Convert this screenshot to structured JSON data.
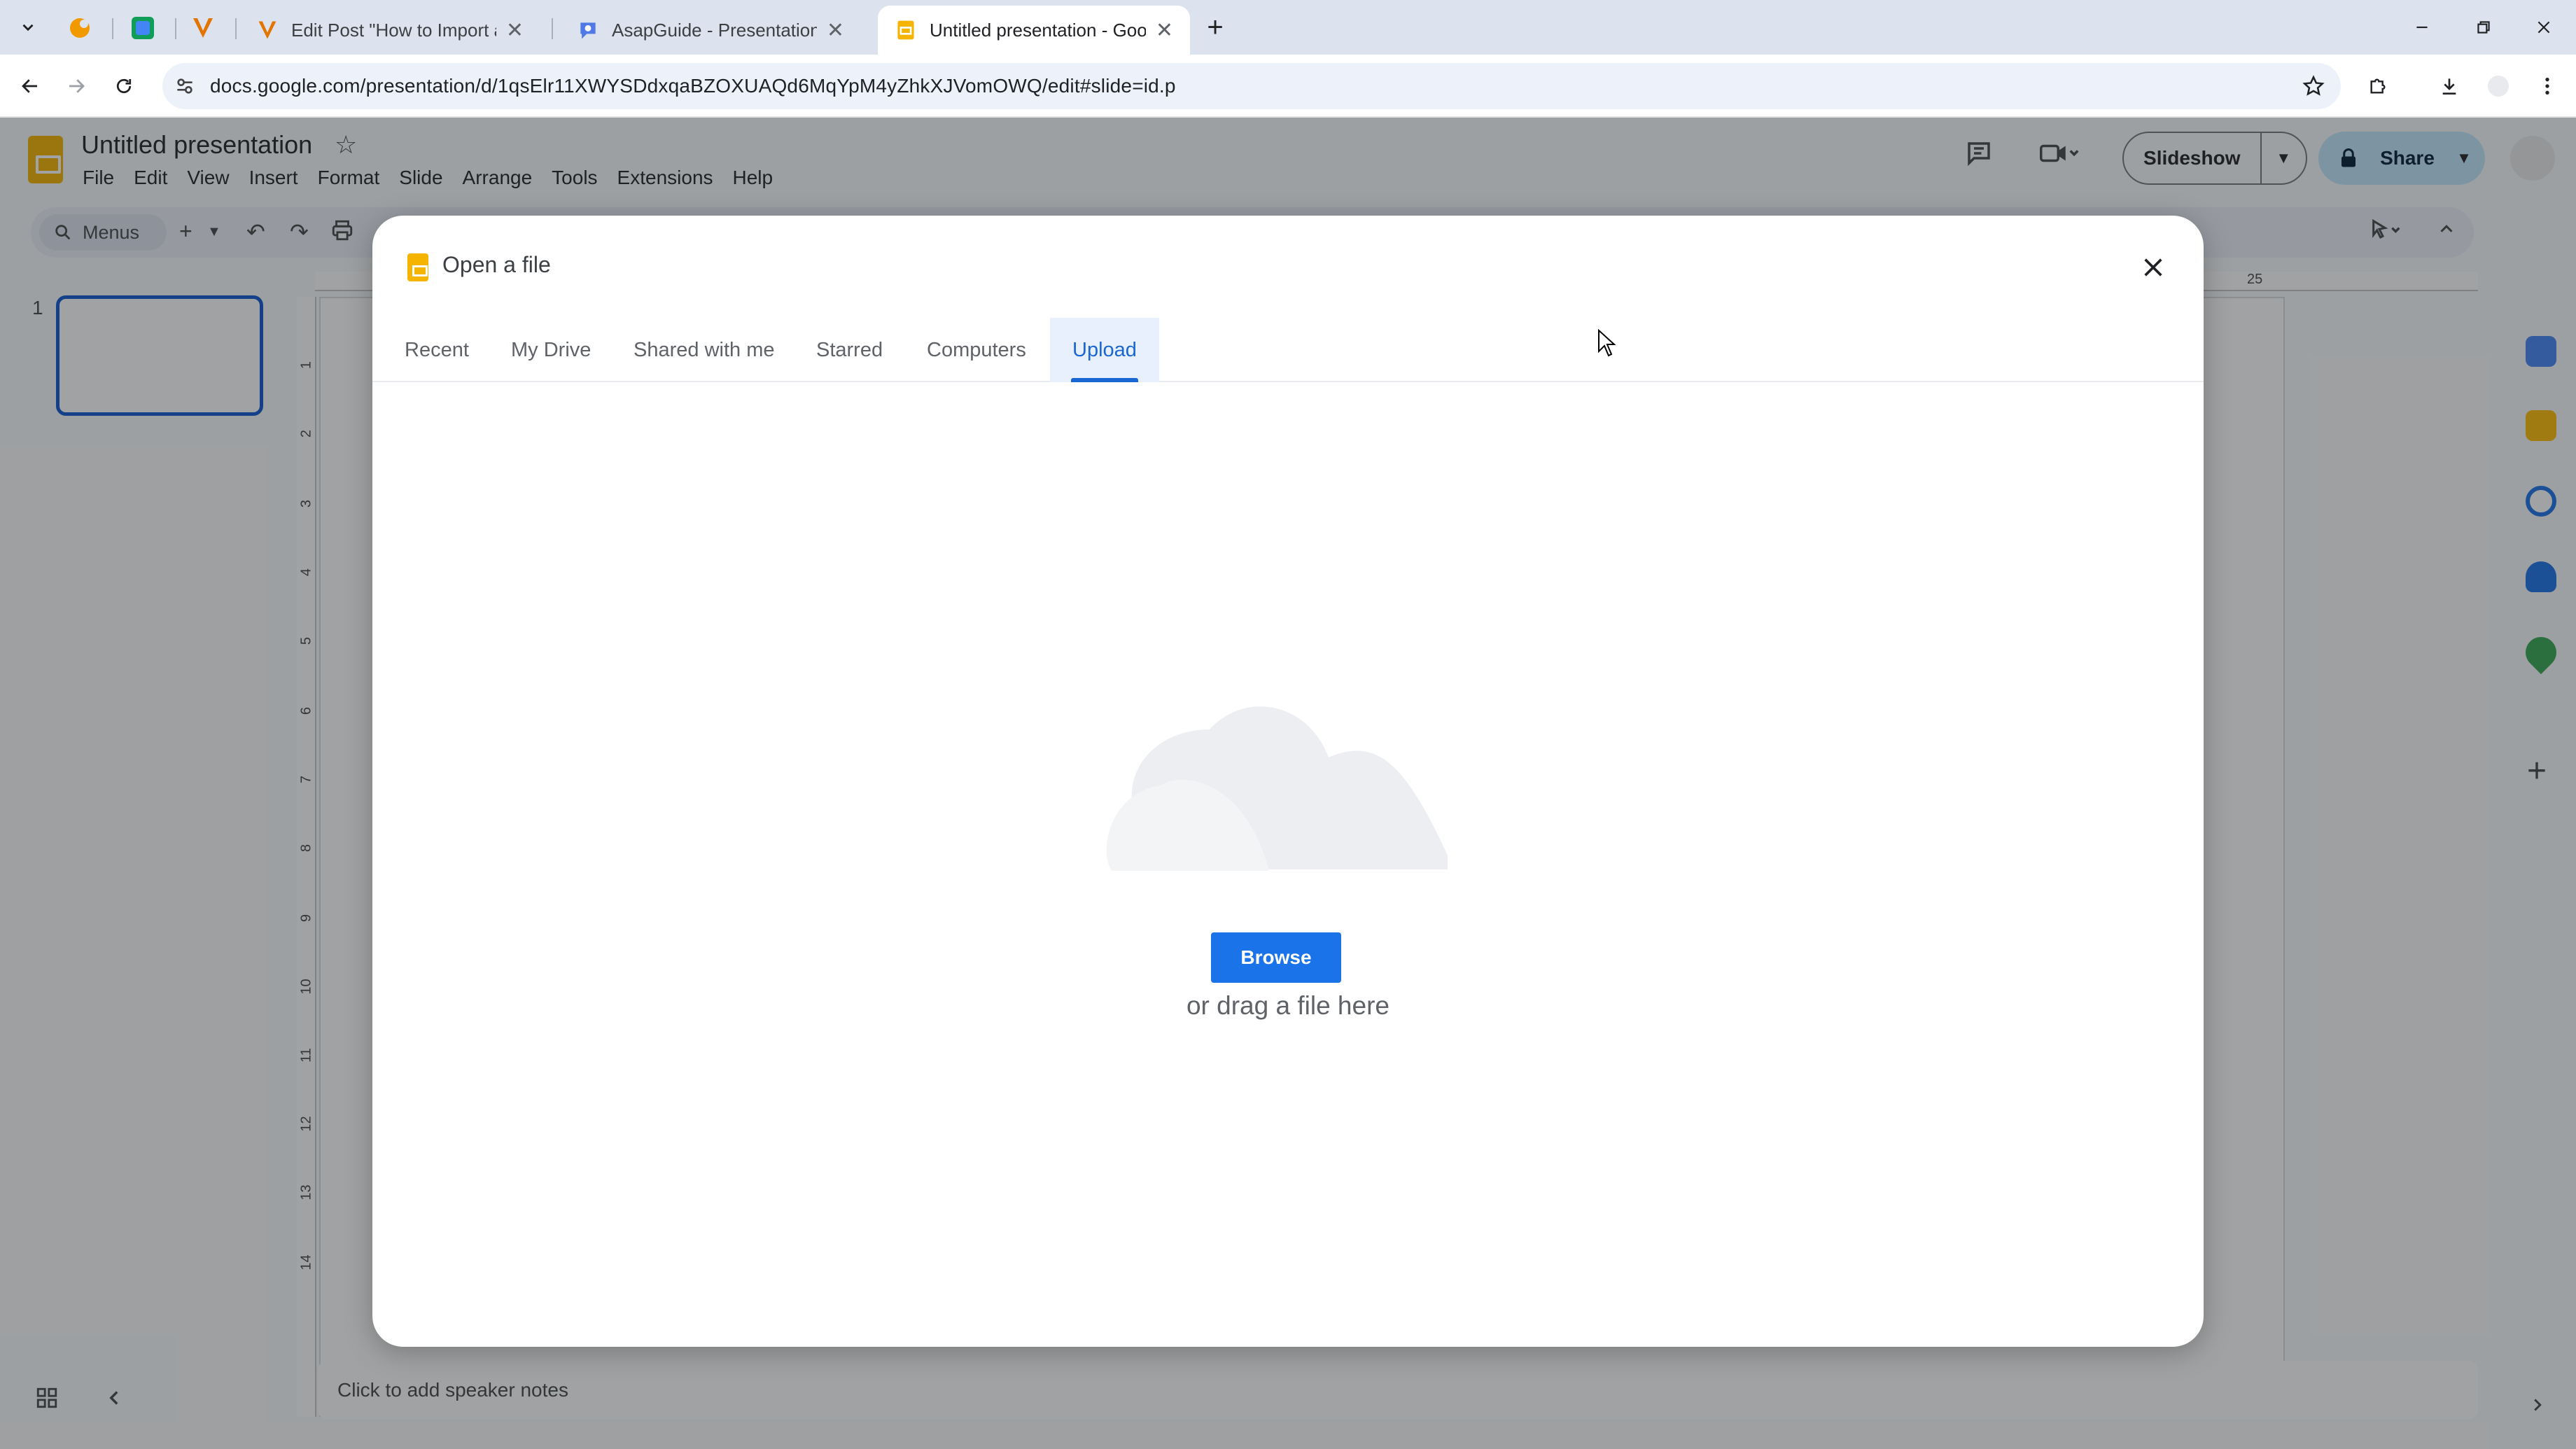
{
  "browser": {
    "tabs": [
      {
        "title": ""
      },
      {
        "title": ""
      },
      {
        "title": ""
      },
      {
        "title": "Edit Post \"How to Import a Can"
      },
      {
        "title": "AsapGuide - Presentation"
      },
      {
        "title": "Untitled presentation - Google",
        "active": true
      }
    ],
    "new_tab_symbol": "+",
    "url": "docs.google.com/presentation/d/1qsElr11XWYSDdxqaBZOXUAQd6MqYpM4yZhkXJVomOWQ/edit#slide=id.p"
  },
  "app": {
    "title": "Untitled presentation",
    "menu": [
      "File",
      "Edit",
      "View",
      "Insert",
      "Format",
      "Slide",
      "Arrange",
      "Tools",
      "Extensions",
      "Help"
    ],
    "slideshow_label": "Slideshow",
    "share_label": "Share",
    "menus_label": "Menus",
    "slide_number": "1",
    "ruler_h_label": "25",
    "ruler_v_labels": [
      "1",
      "2",
      "3",
      "4",
      "5",
      "6",
      "7",
      "8",
      "9",
      "10",
      "11",
      "12",
      "13",
      "14"
    ],
    "speaker_notes_placeholder": "Click to add speaker notes"
  },
  "modal": {
    "title": "Open a file",
    "tabs": [
      "Recent",
      "My Drive",
      "Shared with me",
      "Starred",
      "Computers",
      "Upload"
    ],
    "active_tab": "Upload",
    "browse_label": "Browse",
    "drag_text": "or drag a file here"
  },
  "colors": {
    "accent": "#1a73e8",
    "tab_active": "#1967d2",
    "slides_yellow": "#f4b400"
  }
}
